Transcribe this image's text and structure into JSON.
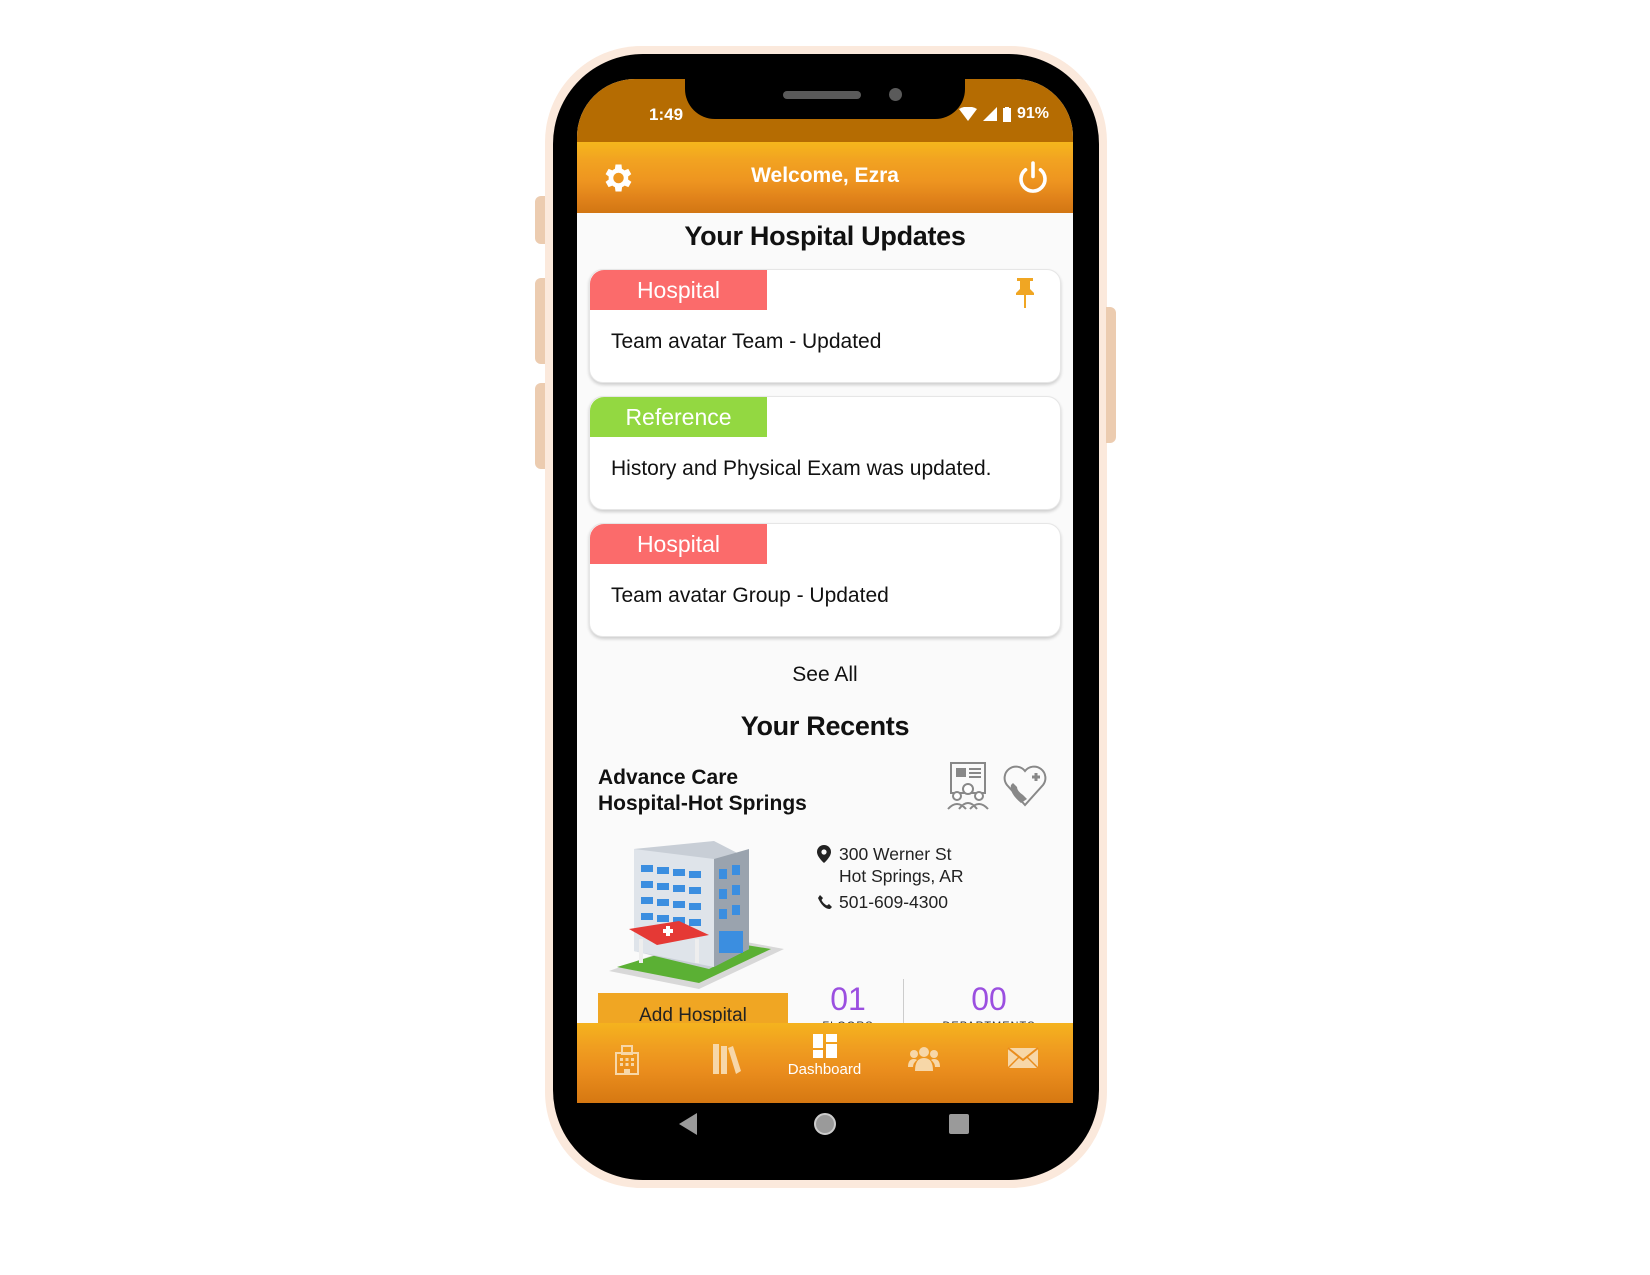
{
  "status_bar": {
    "time": "1:49",
    "battery": "91%"
  },
  "header": {
    "title": "Welcome, Ezra",
    "left_icon": "gear-icon",
    "right_icon": "power-icon"
  },
  "updates": {
    "title": "Your Hospital Updates",
    "items": [
      {
        "tag": "Hospital",
        "tag_color": "#fb6b6b",
        "text": "Team avatar Team - Updated",
        "pinned": true
      },
      {
        "tag": "Reference",
        "tag_color": "#93d841",
        "text": "History and Physical Exam was updated.",
        "pinned": false
      },
      {
        "tag": "Hospital",
        "tag_color": "#fb6b6b",
        "text": "Team avatar Group - Updated",
        "pinned": false
      }
    ],
    "see_all": "See All"
  },
  "recents": {
    "title": "Your Recents",
    "hospital": {
      "name_line1": "Advance Care",
      "name_line2": "Hospital-Hot Springs",
      "address_line1": "300 Werner St",
      "address_line2": "Hot Springs, AR",
      "phone": "501-609-4300",
      "add_button": "Add Hospital",
      "floors_count": "01",
      "floors_label": "FLOORS",
      "departments_count": "00",
      "departments_label": "DEPARTMENTS"
    }
  },
  "bottom_nav": {
    "items": [
      {
        "icon": "hospital-icon",
        "label": ""
      },
      {
        "icon": "library-icon",
        "label": ""
      },
      {
        "icon": "dashboard-icon",
        "label": "Dashboard",
        "active": true
      },
      {
        "icon": "group-icon",
        "label": ""
      },
      {
        "icon": "mail-icon",
        "label": ""
      }
    ]
  },
  "colors": {
    "accent": "#f0a623",
    "status_bar": "#b56c02",
    "count": "#9b4fe0"
  }
}
